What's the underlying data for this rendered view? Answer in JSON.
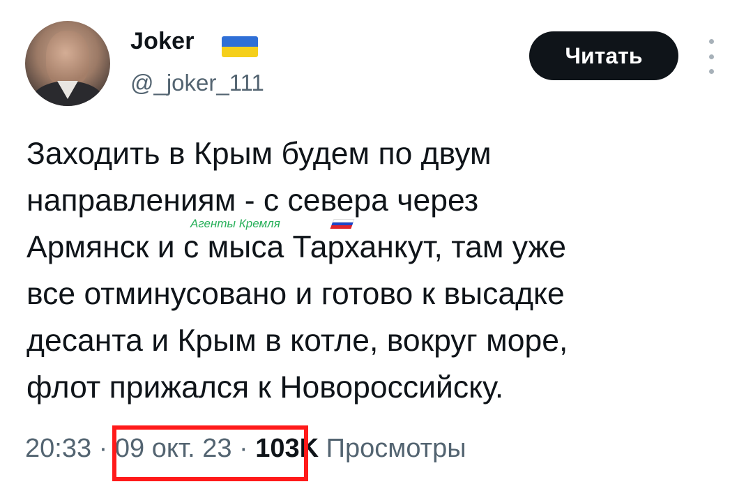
{
  "author": {
    "name": "Joker",
    "flag_icon": "ukraine-flag-icon",
    "handle": "@_joker_111",
    "avatar_icon": "profile-photo"
  },
  "actions": {
    "follow_label": "Читать",
    "more_icon": "more-vertical-icon"
  },
  "tweet": {
    "text": "Заходить в Крым будем по двум\nнаправлениям - с севера через\nАрмянск и с мыса Тарханкут, там уже\nвсе отминусовано и готово к высадке\nдесанта и Крым в котле, вокруг море,\nфлот прижался к Новороссийску."
  },
  "watermark": {
    "text": "Агенты Кремля",
    "flag_icon": "russia-flag-icon"
  },
  "meta": {
    "time": "20:33",
    "separator": "·",
    "date": "09 окт. 23",
    "views_count": "103K",
    "views_label": "Просмотры"
  },
  "colors": {
    "text": "#0f1419",
    "secondary": "#536471",
    "button_bg": "#0f1419",
    "highlight_box": "#ff1a1a",
    "watermark": "#28b05a"
  }
}
